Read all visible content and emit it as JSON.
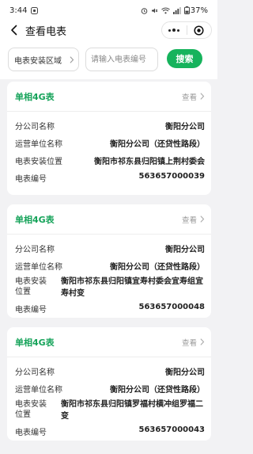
{
  "status_bar": {
    "time": "3:44",
    "battery": "37%"
  },
  "nav": {
    "title": "查看电表"
  },
  "search": {
    "area_placeholder": "电表安装区域",
    "meter_placeholder": "请输入电表编号",
    "button_label": "搜索"
  },
  "labels": {
    "branch": "分公司名称",
    "operator": "运营单位名称",
    "location": "电表安装位置",
    "meter_no": "电表编号",
    "location_wrapped_1": "电表安装",
    "location_wrapped_2": "位置"
  },
  "cards": [
    {
      "type": "单相4G表",
      "view_label": "查看",
      "branch": "衡阳分公司",
      "operator": "衡阳分公司（还贷性路段）",
      "location": "衡阳市祁东县归阳镇上荆村委会",
      "meter_no": "563657000039"
    },
    {
      "type": "单相4G表",
      "view_label": "查看",
      "branch": "衡阳分公司",
      "operator": "衡阳分公司（还贷性路段）",
      "location": "衡阳市祁东县归阳镇宜寿村委会宜寿组宜寿村变",
      "meter_no": "563657000048"
    },
    {
      "type": "单相4G表",
      "view_label": "查看",
      "branch": "衡阳分公司",
      "operator": "衡阳分公司（还贷性路段）",
      "location": "衡阳市祁东县归阳镇罗福村横冲组罗福二变",
      "meter_no": "563657000043"
    }
  ],
  "colors": {
    "accent": "#16b35c",
    "card_title": "#16a35a",
    "background": "#f2f2f4"
  }
}
